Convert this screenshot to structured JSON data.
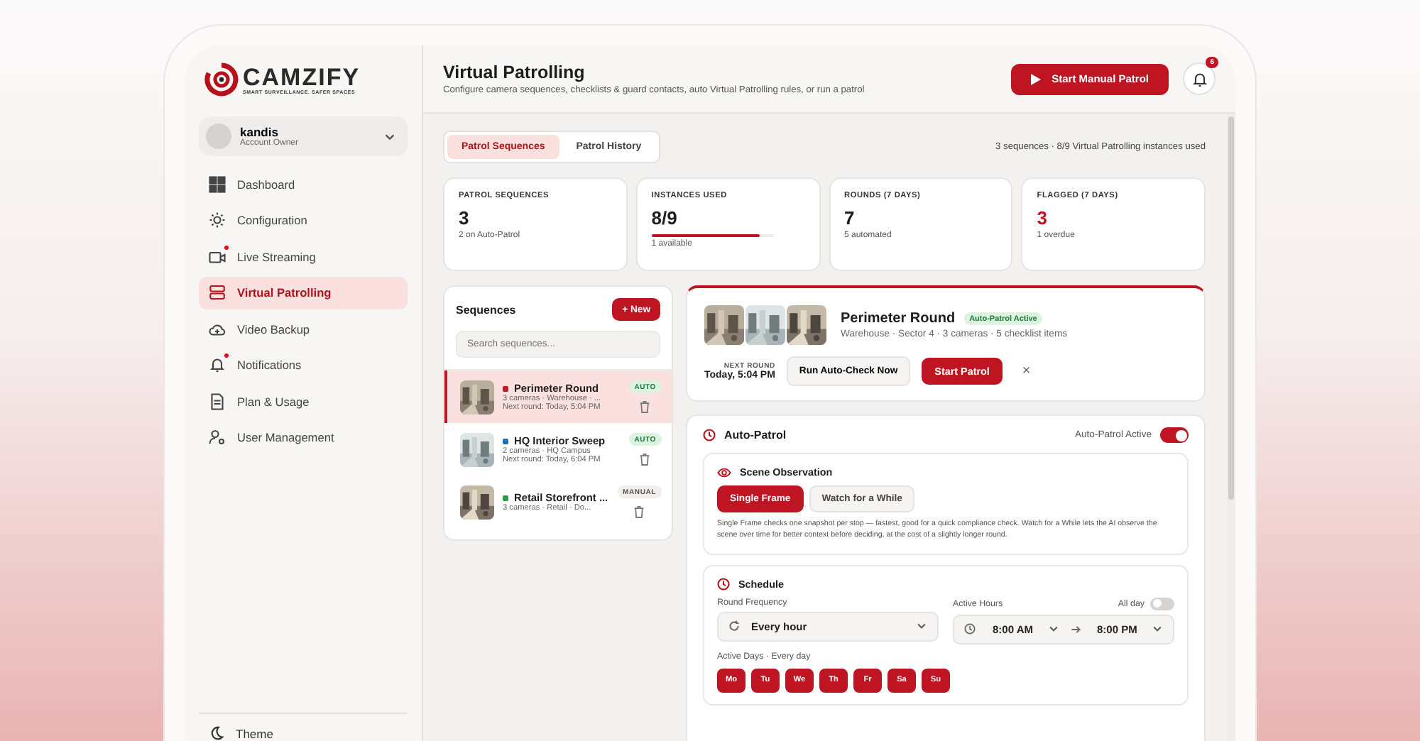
{
  "brand": {
    "name": "CAMZIFY",
    "tagline": "SMART SURVEILLANCE. SAFER SPACES"
  },
  "account": {
    "name": "kandis",
    "role": "Account Owner"
  },
  "nav": [
    {
      "label": "Dashboard",
      "selected": false,
      "dot": false
    },
    {
      "label": "Configuration",
      "selected": false,
      "dot": false
    },
    {
      "label": "Live Streaming",
      "selected": false,
      "dot": true
    },
    {
      "label": "Virtual Patrolling",
      "selected": true,
      "dot": false
    },
    {
      "label": "Video Backup",
      "selected": false,
      "dot": false
    },
    {
      "label": "Notifications",
      "selected": false,
      "dot": true
    },
    {
      "label": "Plan & Usage",
      "selected": false,
      "dot": false
    },
    {
      "label": "User Management",
      "selected": false,
      "dot": false
    }
  ],
  "theme": {
    "label": "Theme"
  },
  "header": {
    "title": "Virtual Patrolling",
    "subtitle": "Configure camera sequences, checklists & guard contacts, auto Virtual Patrolling rules, or run a patrol",
    "start_button": "Start Manual Patrol",
    "notification_count": "6"
  },
  "tabs": [
    {
      "label": "Patrol Sequences",
      "selected": true
    },
    {
      "label": "Patrol History",
      "selected": false
    }
  ],
  "usage_summary": "3 sequences · 8/9 Virtual Patrolling instances used",
  "stats": [
    {
      "label": "PATROL SEQUENCES",
      "value": "3",
      "note": "2 on Auto-Patrol",
      "alert": false
    },
    {
      "label": "INSTANCES USED",
      "value": "8/9",
      "note": "1 available",
      "alert": false,
      "level": 0.89
    },
    {
      "label": "ROUNDS (7 DAYS)",
      "value": "7",
      "note": "5 automated",
      "alert": false
    },
    {
      "label": "FLAGGED (7 DAYS)",
      "value": "3",
      "note": "1 overdue",
      "alert": true
    }
  ],
  "sequences": {
    "title": "Sequences",
    "new_button": "+ New",
    "search": {
      "placeholder": "Search sequences..."
    },
    "items": [
      {
        "name": "Perimeter Round",
        "meta": "3 cameras · Warehouse · ...",
        "next": "Next round: Today, 5:04 PM",
        "badge": "AUTO",
        "kind": "auto",
        "color": "#c0192b",
        "selected": true
      },
      {
        "name": "HQ Interior Sweep",
        "meta": "2 cameras · HQ Campus",
        "next": "Next round: Today, 6:04 PM",
        "badge": "AUTO",
        "kind": "auto",
        "color": "#1f6fb5",
        "selected": false
      },
      {
        "name": "Retail Storefront ...",
        "meta": "3 cameras · Retail · Do...",
        "badge": "MANUAL",
        "kind": "manual",
        "color": "#2e9a48",
        "selected": false
      }
    ]
  },
  "detail": {
    "title": "Perimeter Round",
    "status": "Auto-Patrol Active",
    "meta": "Warehouse · Sector 4 · 3 cameras · 5 checklist items",
    "next_label": "NEXT ROUND",
    "next_value": "Today, 5:04 PM",
    "run_button": "Run Auto-Check Now",
    "start_button": "Start Patrol",
    "close": "×"
  },
  "auto_patrol": {
    "title": "Auto-Patrol",
    "toggle_label": "Auto-Patrol Active",
    "on": true,
    "scene": {
      "title": "Scene Observation",
      "options": [
        {
          "label": "Single Frame",
          "selected": true
        },
        {
          "label": "Watch for a While",
          "selected": false
        }
      ],
      "description": "Single Frame checks one snapshot per stop — fastest, good for a quick compliance check. Watch for a While lets the AI observe the scene over time for better context before deciding, at the cost of a slightly longer round."
    },
    "schedule": {
      "title": "Schedule",
      "frequency_label": "Round Frequency",
      "frequency": "Every hour",
      "hours_label": "Active Hours",
      "all_day_label": "All day",
      "all_day": false,
      "from": "8:00 AM",
      "to": "8:00 PM",
      "days_label": "Active Days · Every day",
      "days": [
        {
          "label": "Mo",
          "selected": true
        },
        {
          "label": "Tu",
          "selected": true
        },
        {
          "label": "We",
          "selected": true
        },
        {
          "label": "Th",
          "selected": true
        },
        {
          "label": "Fr",
          "selected": true
        },
        {
          "label": "Sa",
          "selected": true
        },
        {
          "label": "Su",
          "selected": true
        }
      ]
    }
  }
}
